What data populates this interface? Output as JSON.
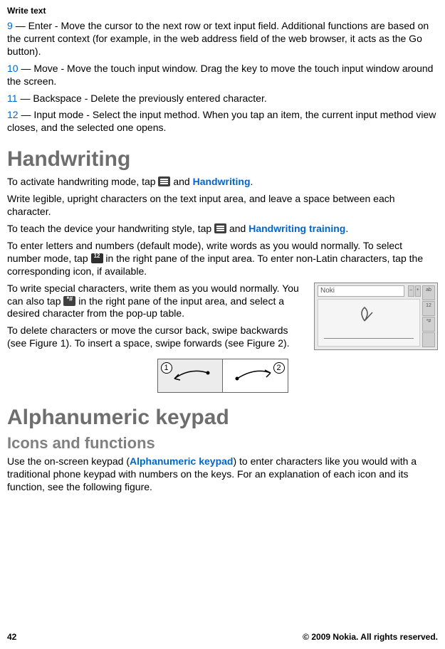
{
  "header": {
    "title": "Write text"
  },
  "items": [
    {
      "num": "9",
      "text": "— Enter - Move the cursor to the next row or text input field. Additional functions are based on the current context (for example, in the web address field of the web browser, it acts as the Go button)."
    },
    {
      "num": "10",
      "text": "— Move - Move the touch input window. Drag the key to move the touch input window around the screen."
    },
    {
      "num": "11",
      "text": "— Backspace - Delete the previously entered character."
    },
    {
      "num": "12",
      "text": "— Input mode - Select the input method. When you tap an item, the current input method view closes, and the selected one opens."
    }
  ],
  "handwriting": {
    "title": "Handwriting",
    "p1a": "To activate handwriting mode, tap ",
    "p1b": " and ",
    "p1link": "Handwriting",
    "p1c": ".",
    "p2": "Write legible, upright characters on the text input area, and leave a space between each character.",
    "p3a": "To teach the device your handwriting style, tap ",
    "p3b": " and ",
    "p3link": "Handwriting training",
    "p3c": ".",
    "p4a": "To enter letters and numbers (default mode), write words as you would normally. To select number mode, tap ",
    "p4b": " in the right pane of the input area. To enter non-Latin characters, tap the corresponding icon, if available.",
    "p5a": "To write special characters, write them as you would normally. You can also tap ",
    "p5b": " in the right pane of the input area, and select a desired character from the pop-up table.",
    "p6": "To delete characters or move the cursor back, swipe backwards (see Figure 1). To insert a space, swipe forwards (see Figure 2).",
    "panel": {
      "sample_text": "Noki",
      "btns": [
        "ab",
        "12",
        "*#",
        ""
      ]
    },
    "fig": {
      "b1": "1",
      "b2": "2"
    }
  },
  "alpha": {
    "title": "Alphanumeric keypad",
    "subtitle": "Icons and functions",
    "p1a": "Use the on-screen keypad (",
    "p1link": "Alphanumeric keypad",
    "p1b": ") to enter characters like you would with a traditional phone keypad with numbers on the keys. For an explanation of each icon and its function, see the following figure."
  },
  "footer": {
    "page": "42",
    "copyright": "© 2009 Nokia. All rights reserved."
  }
}
